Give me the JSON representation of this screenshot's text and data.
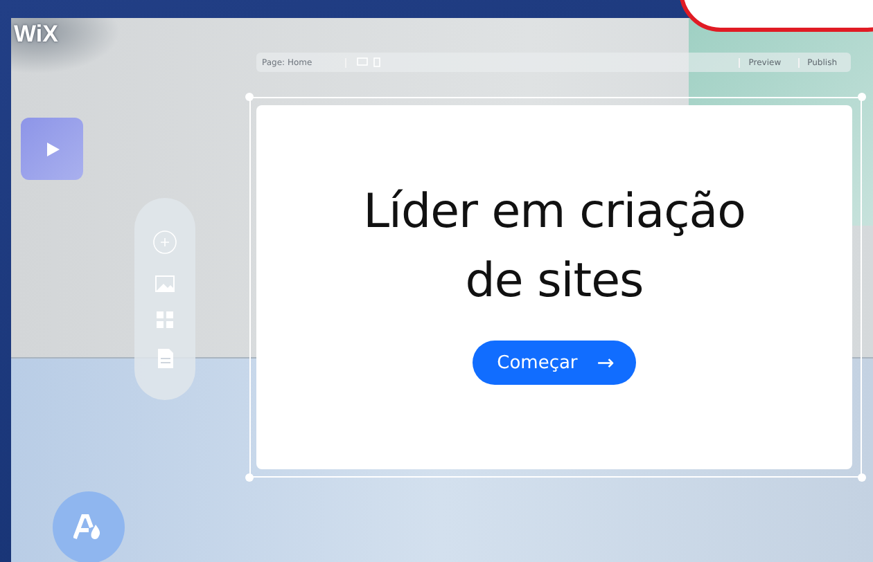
{
  "logo": "WiX",
  "toolbar": {
    "page_selector": "Page: Home",
    "buttons": [
      "Preview",
      "Publish"
    ]
  },
  "hero": {
    "title": "Líder em criação de sites",
    "cta": "Começar",
    "cta_arrow": "→"
  }
}
